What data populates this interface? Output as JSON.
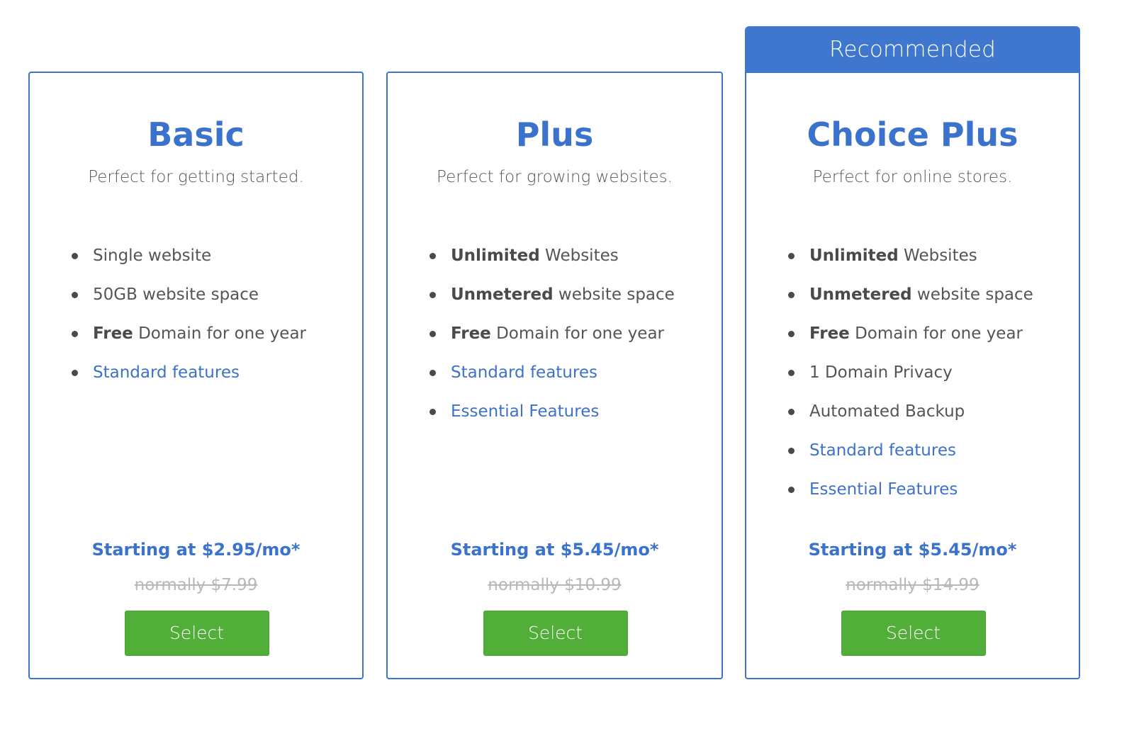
{
  "colors": {
    "accent_blue": "#3a72cc",
    "banner_blue": "#3f77cf",
    "select_green": "#51ae38",
    "text_gray": "#555555",
    "strikethrough_gray": "#b8b8b8"
  },
  "recommended_label": "Recommended",
  "plans": [
    {
      "name": "Basic",
      "description": "Perfect for getting started.",
      "features": [
        {
          "bold": "",
          "text": "Single website",
          "link": false
        },
        {
          "bold": "",
          "text": "50GB website space",
          "link": false
        },
        {
          "bold": "Free",
          "text": " Domain for one year",
          "link": false
        },
        {
          "bold": "",
          "text": "Standard features",
          "link": true
        }
      ],
      "price": "Starting at $2.95/mo*",
      "normal_price": "normally $7.99",
      "button_label": "Select"
    },
    {
      "name": "Plus",
      "description": "Perfect for growing websites.",
      "features": [
        {
          "bold": "Unlimited",
          "text": " Websites",
          "link": false
        },
        {
          "bold": "Unmetered",
          "text": " website space",
          "link": false
        },
        {
          "bold": "Free",
          "text": " Domain for one year",
          "link": false
        },
        {
          "bold": "",
          "text": "Standard features",
          "link": true
        },
        {
          "bold": "",
          "text": "Essential Features",
          "link": true
        }
      ],
      "price": "Starting at $5.45/mo*",
      "normal_price": "normally $10.99",
      "button_label": "Select"
    },
    {
      "name": "Choice Plus",
      "description": "Perfect for online stores.",
      "features": [
        {
          "bold": "Unlimited",
          "text": " Websites",
          "link": false
        },
        {
          "bold": "Unmetered",
          "text": " website space",
          "link": false
        },
        {
          "bold": "Free",
          "text": " Domain for one year",
          "link": false
        },
        {
          "bold": "",
          "text": "1 Domain Privacy",
          "link": false
        },
        {
          "bold": "",
          "text": "Automated Backup",
          "link": false
        },
        {
          "bold": "",
          "text": "Standard features",
          "link": true
        },
        {
          "bold": "",
          "text": "Essential Features",
          "link": true
        }
      ],
      "price": "Starting at $5.45/mo*",
      "normal_price": "normally $14.99",
      "button_label": "Select",
      "recommended": true
    }
  ]
}
